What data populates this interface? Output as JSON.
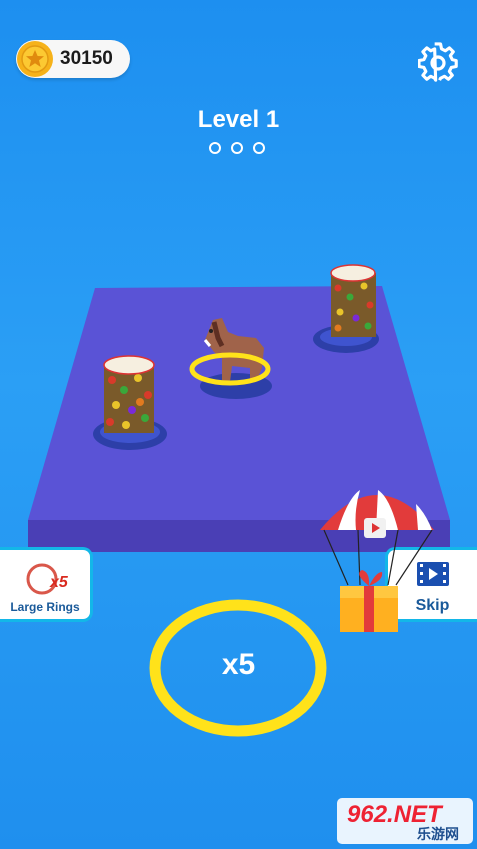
{
  "hud": {
    "coins": "30150",
    "level_title": "Level 1",
    "progress_dots": 3
  },
  "powerups": {
    "large_rings_label": "Large Rings",
    "large_rings_badge": "x5",
    "skip_label": "Skip"
  },
  "ring": {
    "count_label": "x5"
  },
  "watermark": {
    "logo": "962.NET",
    "sub": "乐游网"
  },
  "colors": {
    "sky": "#1f8fee",
    "board_top": "#5a53d6",
    "board_side": "#4a3fb5",
    "ring_yellow": "#ffe21a",
    "card_border": "#13b7e8",
    "coin_gold": "#f6b21a"
  }
}
